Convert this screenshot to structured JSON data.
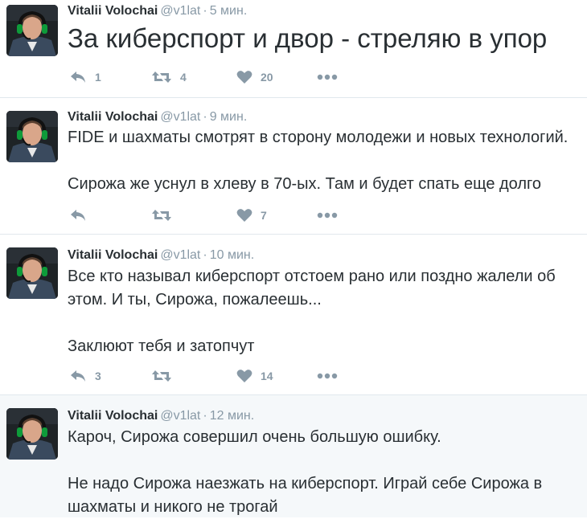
{
  "tweets": [
    {
      "name": "Vitalii Volochai",
      "handle": "@v1lat",
      "separator": "·",
      "time": "5 мин.",
      "text": "За киберспорт и двор - стреляю в упор",
      "replies": "1",
      "retweets": "4",
      "likes": "20"
    },
    {
      "name": "Vitalii Volochai",
      "handle": "@v1lat",
      "separator": "·",
      "time": "9 мин.",
      "text": "FIDE и шахматы смотрят в сторону молодежи и новых технологий.\n\nСирожа же уснул в хлеву в 70-ых. Там и будет спать еще долго",
      "replies": "",
      "retweets": "",
      "likes": "7"
    },
    {
      "name": "Vitalii Volochai",
      "handle": "@v1lat",
      "separator": "·",
      "time": "10 мин.",
      "text": "Все кто называл киберспорт отстоем рано или поздно жалели об этом. И ты, Сирожа, пожалеешь...\n\nЗаклюют тебя и затопчут",
      "replies": "3",
      "retweets": "",
      "likes": "14"
    },
    {
      "name": "Vitalii Volochai",
      "handle": "@v1lat",
      "separator": "·",
      "time": "12 мин.",
      "text": "Кароч, Сирожа совершил очень большую ошибку.\n\nНе надо Сирожа наезжать на киберспорт. Играй себе Сирожа в шахматы и никого не трогай",
      "replies": "",
      "retweets": "",
      "likes": ""
    }
  ],
  "colors": {
    "action_gray": "#8899a6",
    "text": "#292f33",
    "divider": "#e1e8ed",
    "shaded_bg": "#f5f8fa"
  },
  "icons": [
    "reply-icon",
    "retweet-icon",
    "heart-icon",
    "more-icon"
  ]
}
